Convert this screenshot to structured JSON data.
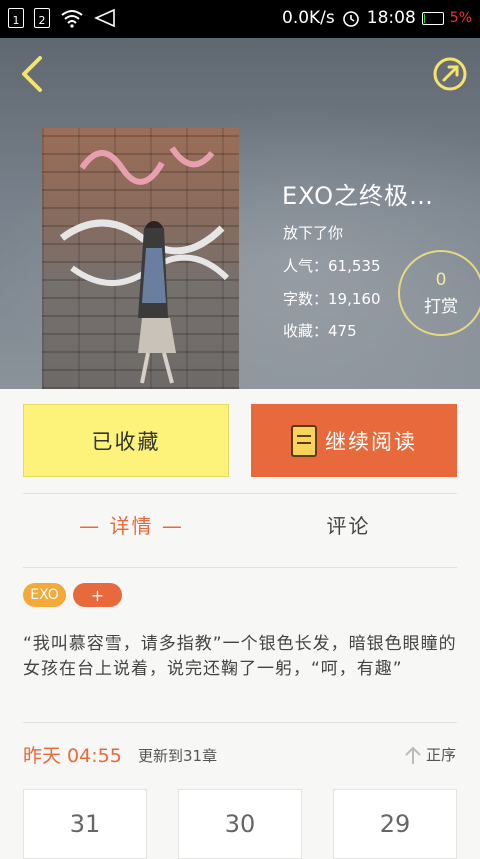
{
  "status_bar": {
    "sim1": "1",
    "sim2": "2",
    "speed": "0.0K/s",
    "time": "18:08",
    "battery_pct": "5%",
    "battery_level": 0.05
  },
  "book": {
    "title": "EXO之终极…",
    "author": "放下了你",
    "popularity": "人气：61,535",
    "word_count": "字数：19,160",
    "favorites": "收藏：475"
  },
  "reward": {
    "count": "0",
    "label": "打赏"
  },
  "actions": {
    "favorited_label": "已收藏",
    "continue_label": "继续阅读"
  },
  "tabs": {
    "detail": "— 详情 —",
    "comments": "评论"
  },
  "tags": {
    "tag1": "EXO",
    "add": "+"
  },
  "description": "“我叫慕容雪，请多指教”一个银色长发，暗银色眼瞳的女孩在台上说着，说完还鞠了一躬，“呵，有趣”",
  "update": {
    "time": "昨天 04:55",
    "text": "更新到31章",
    "order_label": "正序"
  },
  "chapters": [
    "31",
    "30",
    "29"
  ],
  "colors": {
    "accent": "#e8693b",
    "favorite_bg": "#fdf37a",
    "tag_bg": "#f5a93a"
  }
}
